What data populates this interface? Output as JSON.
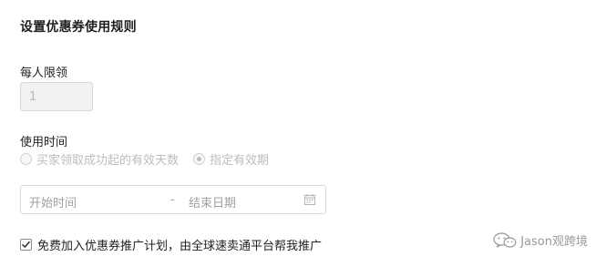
{
  "section": {
    "title": "设置优惠券使用规则"
  },
  "limit": {
    "label": "每人限领",
    "value": "1"
  },
  "usage_time": {
    "label": "使用时间",
    "options": [
      {
        "label": "买家领取成功起的有效天数",
        "selected": false
      },
      {
        "label": "指定有效期",
        "selected": true
      }
    ]
  },
  "date_range": {
    "start_placeholder": "开始时间",
    "separator": "-",
    "end_placeholder": "结束日期",
    "icon": "calendar-icon"
  },
  "promotion": {
    "label": "免费加入优惠券推广计划，由全球速卖通平台帮我推广",
    "checked": true
  },
  "watermark": {
    "icon": "wechat-icon",
    "text": "Jason观跨境"
  }
}
